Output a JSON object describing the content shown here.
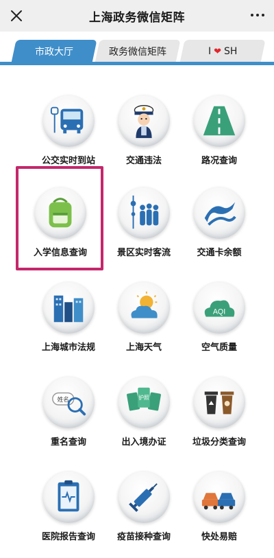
{
  "header": {
    "title": "上海政务微信矩阵",
    "close_icon": "close-icon",
    "more_icon": "more-dots-icon"
  },
  "tabs": [
    {
      "label": "市政大厅",
      "active": true
    },
    {
      "label": "政务微信矩阵",
      "active": false
    },
    {
      "label_prefix": "I",
      "label_suffix": "SH",
      "icon": "heart-icon",
      "active": false
    }
  ],
  "services": [
    {
      "label": "公交实时到站",
      "icon": "bus-icon"
    },
    {
      "label": "交通违法",
      "icon": "traffic-police-icon"
    },
    {
      "label": "路况查询",
      "icon": "road-icon"
    },
    {
      "label": "入学信息查询",
      "icon": "school-bag-icon",
      "highlighted": true
    },
    {
      "label": "景区实时客流",
      "icon": "tower-crowd-icon"
    },
    {
      "label": "交通卡余额",
      "icon": "transport-card-icon"
    },
    {
      "label": "上海城市法规",
      "icon": "city-buildings-icon"
    },
    {
      "label": "上海天气",
      "icon": "weather-icon"
    },
    {
      "label": "空气质量",
      "icon": "aqi-cloud-icon",
      "icon_text": "AQI"
    },
    {
      "label": "重名查询",
      "icon": "name-search-icon",
      "icon_text": "姓名"
    },
    {
      "label": "出入境办证",
      "icon": "passport-icon",
      "icon_text": "护照"
    },
    {
      "label": "垃圾分类查询",
      "icon": "trash-bins-icon"
    },
    {
      "label": "医院报告查询",
      "icon": "clipboard-icon"
    },
    {
      "label": "疫苗接种查询",
      "icon": "syringe-icon"
    },
    {
      "label": "快处易赔",
      "icon": "cars-icon"
    }
  ],
  "colors": {
    "accent": "#3f8ec9",
    "highlight": "#c4276b"
  }
}
